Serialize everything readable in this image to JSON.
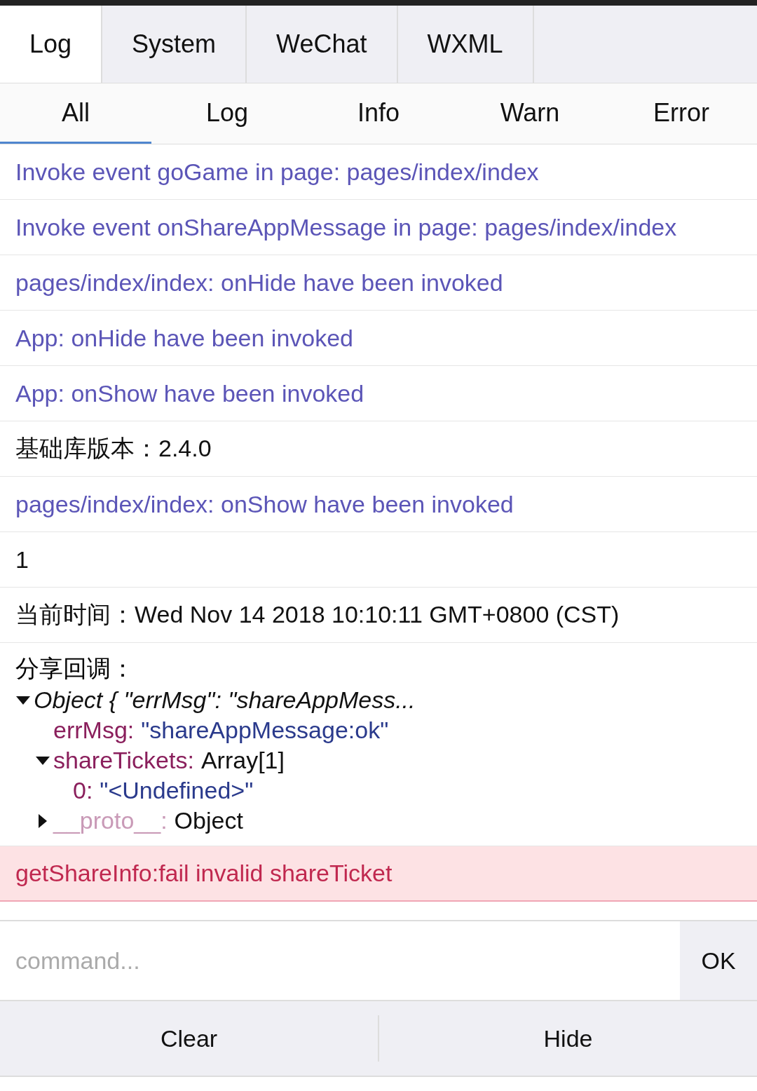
{
  "tabs": [
    {
      "label": "Log",
      "selected": true
    },
    {
      "label": "System",
      "selected": false
    },
    {
      "label": "WeChat",
      "selected": false
    },
    {
      "label": "WXML",
      "selected": false
    }
  ],
  "filters": [
    {
      "label": "All",
      "selected": true
    },
    {
      "label": "Log",
      "selected": false
    },
    {
      "label": "Info",
      "selected": false
    },
    {
      "label": "Warn",
      "selected": false
    },
    {
      "label": "Error",
      "selected": false
    }
  ],
  "logs": [
    {
      "kind": "info",
      "text": "Invoke event goGame in page: pages/index/index"
    },
    {
      "kind": "info",
      "text": "Invoke event onShareAppMessage in page: pages/index/index"
    },
    {
      "kind": "info",
      "text": "pages/index/index: onHide have been invoked"
    },
    {
      "kind": "info",
      "text": "App: onHide have been invoked"
    },
    {
      "kind": "info",
      "text": "App: onShow have been invoked"
    },
    {
      "kind": "log",
      "text": "基础库版本：2.4.0"
    },
    {
      "kind": "info",
      "text": "pages/index/index: onShow have been invoked"
    },
    {
      "kind": "log",
      "text": "1"
    },
    {
      "kind": "log",
      "text": "当前时间：Wed Nov 14 2018 10:10:11 GMT+0800 (CST)"
    },
    {
      "kind": "object",
      "text": "分享回调：",
      "tree": {
        "summary": "Object { \"errMsg\": \"shareAppMess...",
        "expanded": true,
        "children": [
          {
            "key": "errMsg:",
            "value": "\"shareAppMessage:ok\"",
            "kind": "string"
          },
          {
            "key": "shareTickets:",
            "value": "Array[1]",
            "kind": "plain",
            "expanded": true,
            "children": [
              {
                "key": "0:",
                "value": "\"<Undefined>\"",
                "kind": "string"
              }
            ]
          },
          {
            "key": "__proto__:",
            "value": "Object",
            "kind": "plain",
            "expanded": false,
            "private": true
          }
        ]
      }
    },
    {
      "kind": "error",
      "text": "getShareInfo:fail invalid shareTicket"
    }
  ],
  "command": {
    "placeholder": "command...",
    "button": "OK"
  },
  "footer": [
    "Clear",
    "Hide"
  ]
}
